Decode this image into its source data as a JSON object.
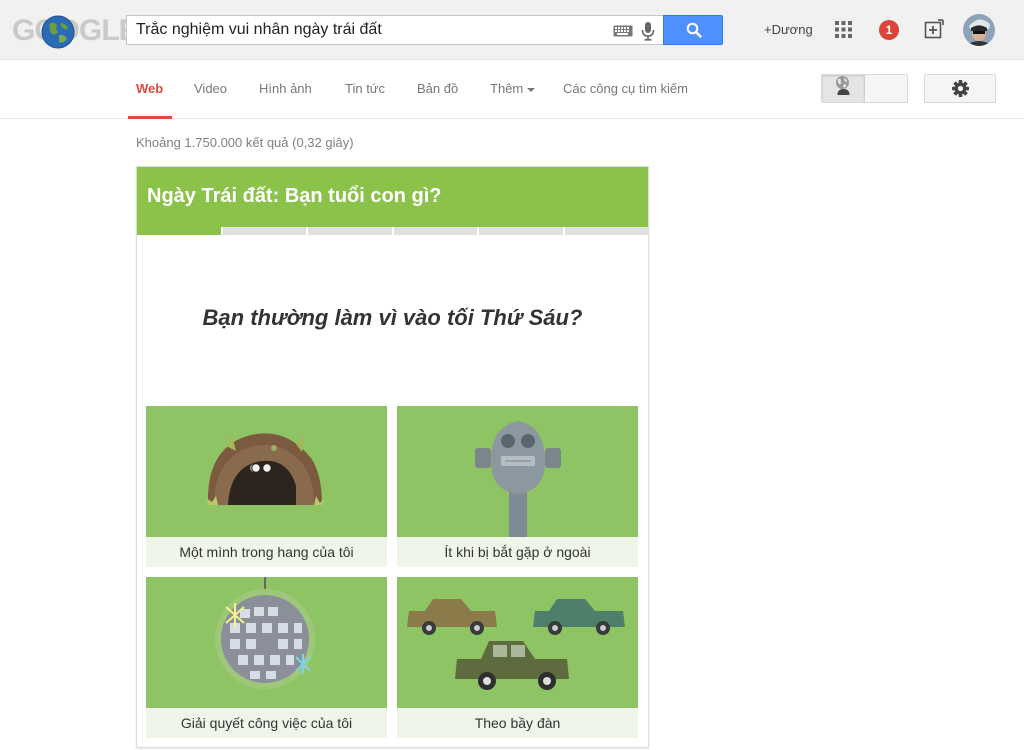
{
  "header": {
    "logo_text": "GOOGLE",
    "search_value": "Trắc nghiệm vui nhân ngày trái đất",
    "user_link": "+Dương",
    "notification_count": "1"
  },
  "tabs": [
    {
      "label": "Web",
      "active": true
    },
    {
      "label": "Video"
    },
    {
      "label": "Hình ảnh"
    },
    {
      "label": "Tin tức"
    },
    {
      "label": "Bản đồ"
    },
    {
      "label": "Thêm"
    },
    {
      "label": "Các công cụ tìm kiếm"
    }
  ],
  "results": {
    "stats": "Khoảng 1.750.000 kết quả (0,32 giây)"
  },
  "quiz": {
    "title": "Ngày Trái đất: Bạn tuổi con gì?",
    "progress": {
      "current": 1,
      "total": 6
    },
    "question": "Bạn thường làm vì vào tối Thứ Sáu?",
    "answers": [
      {
        "label": "Một mình trong hang của tôi"
      },
      {
        "label": "Ít khi bị bắt gặp ở ngoài"
      },
      {
        "label": "Giải quyết công việc của tôi"
      },
      {
        "label": "Theo bầy đàn"
      }
    ]
  },
  "colors": {
    "quiz_green": "#8bc34a",
    "answer_green": "#8fc465",
    "active_tab": "#dd4b39",
    "search_blue": "#4d90fe",
    "notification_red": "#db4437"
  },
  "icons": {
    "keyboard": "keyboard-icon",
    "mic": "microphone-icon",
    "search": "search-icon",
    "apps": "apps-grid-icon",
    "share": "share-plus-icon",
    "person": "person-icon",
    "globe": "globe-icon",
    "settings": "gear-icon"
  }
}
